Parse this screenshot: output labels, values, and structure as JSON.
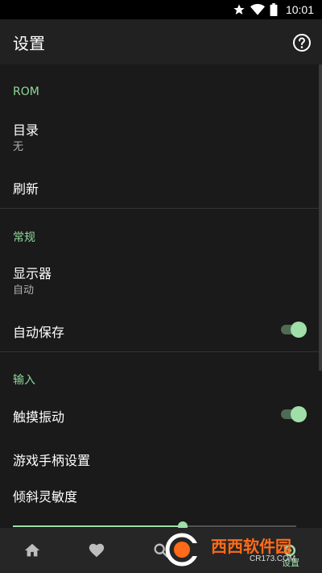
{
  "status_bar": {
    "time": "10:01",
    "icons": [
      "star-icon",
      "wifi-icon",
      "battery-icon"
    ]
  },
  "app_bar": {
    "title": "设置",
    "help_icon": "help-circle-icon"
  },
  "sections": {
    "rom": {
      "header": "ROM",
      "directory": {
        "title": "目录",
        "summary": "无"
      },
      "refresh": {
        "title": "刷新"
      }
    },
    "general": {
      "header": "常规",
      "display": {
        "title": "显示器",
        "summary": "自动"
      },
      "autosave": {
        "title": "自动保存",
        "enabled": true
      }
    },
    "input": {
      "header": "输入",
      "haptic": {
        "title": "触摸振动",
        "enabled": true
      },
      "gamepad": {
        "title": "游戏手柄设置"
      },
      "tilt": {
        "title": "倾斜灵敏度",
        "value": 0.6
      }
    }
  },
  "bottom_nav": {
    "items": [
      {
        "icon": "home-icon"
      },
      {
        "icon": "heart-icon"
      },
      {
        "icon": "search-icon"
      },
      {
        "icon": "settings-icon",
        "label": "设置"
      }
    ]
  },
  "watermark": {
    "text": "西西软件园",
    "sub": "CR173.COM",
    "logo_letter": "C"
  },
  "colors": {
    "accent": "#9ee0a8",
    "section_header": "#8fd89a",
    "background": "#1a1a1a",
    "app_bar": "#212121",
    "watermark": "#ff6b1a"
  }
}
